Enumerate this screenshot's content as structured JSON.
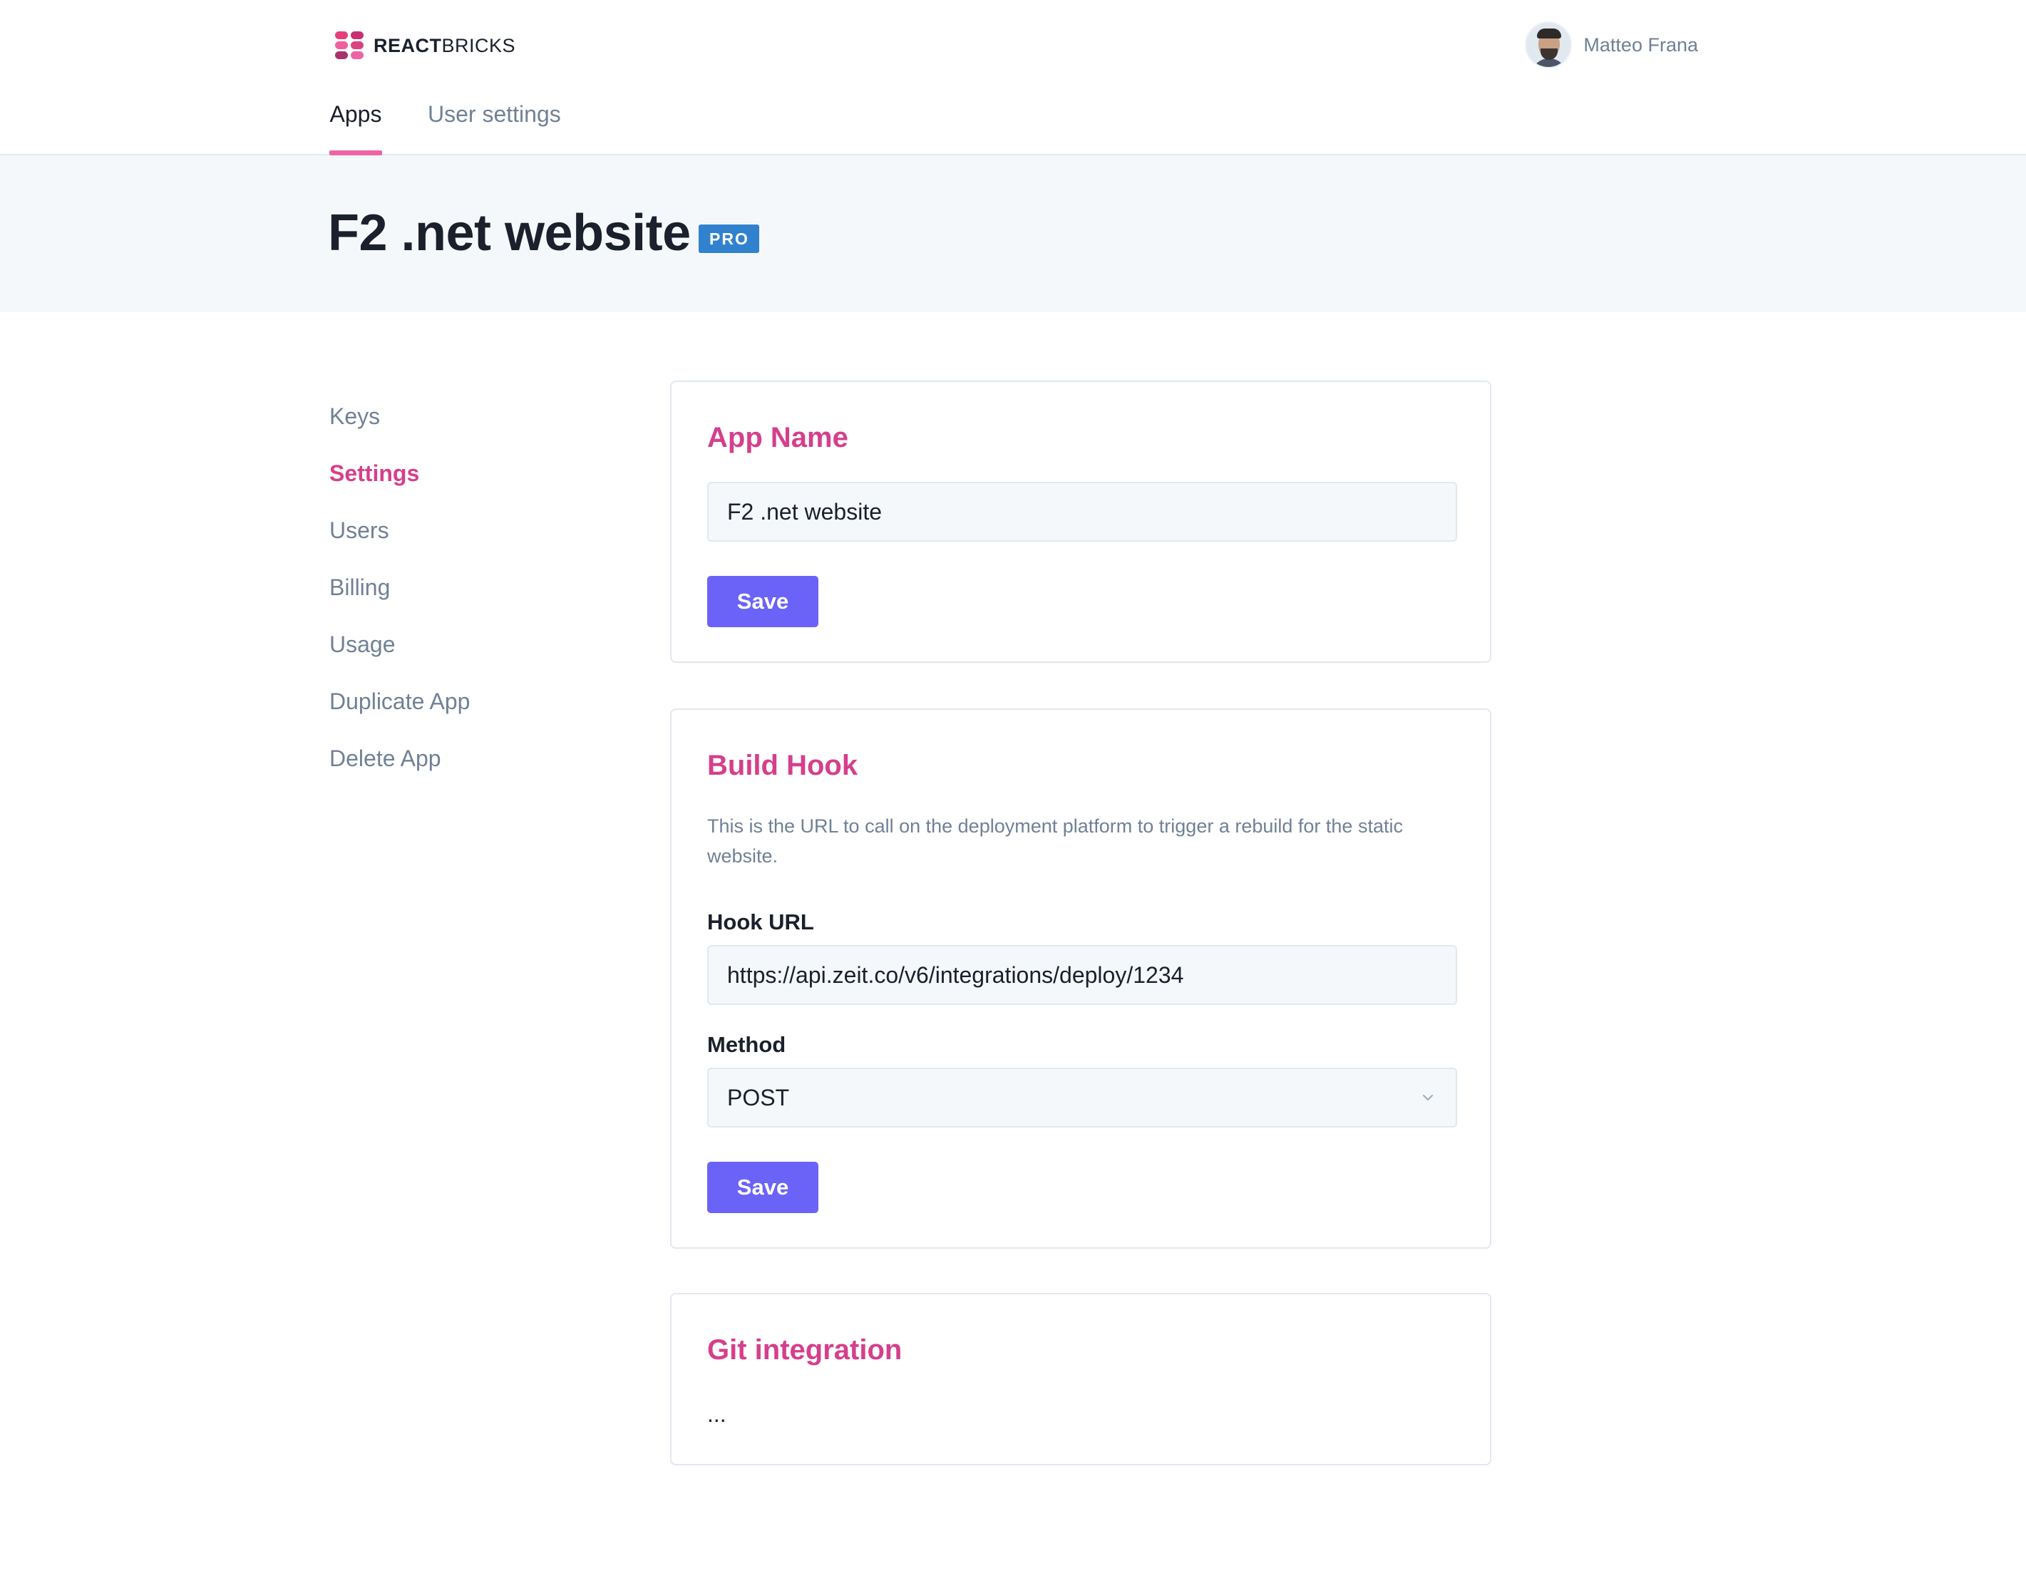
{
  "brand": {
    "logo_bold": "REACT",
    "logo_light": "BRICKS",
    "colors": [
      "#e53e7a",
      "#c53072",
      "#f0609e",
      "#d6457f",
      "#a8326b",
      "#ed64a6"
    ]
  },
  "user": {
    "name": "Matteo Frana"
  },
  "tabs": [
    {
      "label": "Apps",
      "active": true
    },
    {
      "label": "User settings",
      "active": false
    }
  ],
  "page": {
    "title": "F2 .net website",
    "badge": "PRO"
  },
  "sidenav": {
    "items": [
      {
        "label": "Keys"
      },
      {
        "label": "Settings",
        "active": true
      },
      {
        "label": "Users"
      },
      {
        "label": "Billing"
      },
      {
        "label": "Usage"
      },
      {
        "label": "Duplicate App"
      },
      {
        "label": "Delete App"
      }
    ]
  },
  "app_name": {
    "heading": "App Name",
    "value": "F2 .net website",
    "save_label": "Save"
  },
  "build_hook": {
    "heading": "Build Hook",
    "description": "This is the URL to call on the deployment platform to trigger a rebuild for the static website.",
    "url_label": "Hook URL",
    "url_value": "https://api.zeit.co/v6/integrations/deploy/1234",
    "method_label": "Method",
    "method_value": "POST",
    "save_label": "Save"
  },
  "git": {
    "heading": "Git integration",
    "body": "..."
  },
  "theme": {
    "accent": "#d53f8c",
    "button": "#6b63f7",
    "badge": "#3182ce",
    "muted": "#718096"
  }
}
